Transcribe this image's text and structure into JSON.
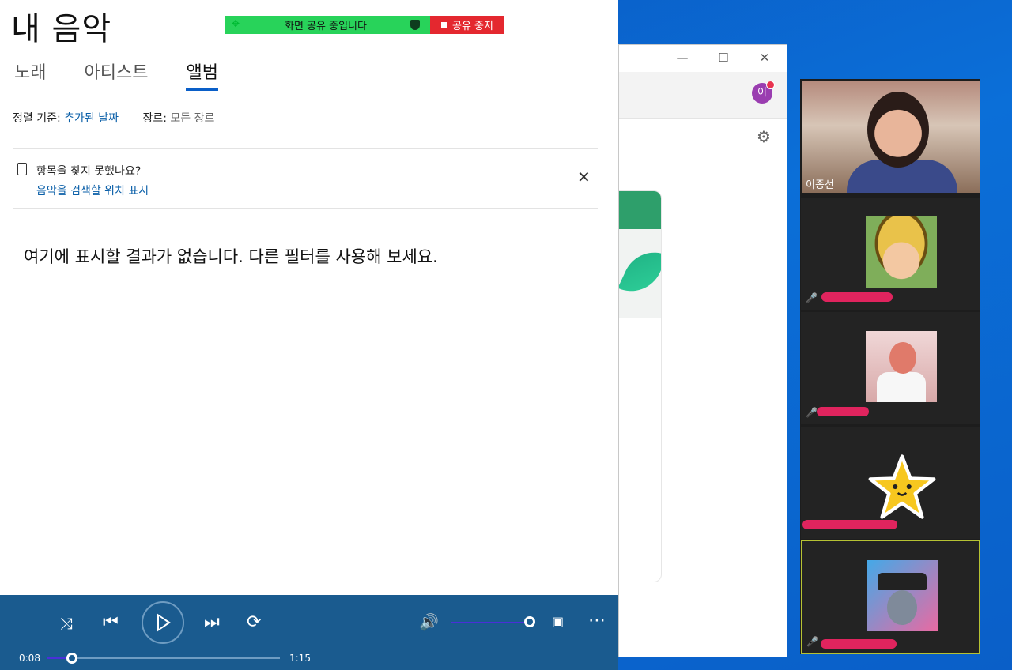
{
  "app": {
    "title": "내 음악",
    "tabs": [
      {
        "label": "노래",
        "active": false
      },
      {
        "label": "아티스트",
        "active": false
      },
      {
        "label": "앨범",
        "active": true
      }
    ],
    "sort_label": "정렬 기준:",
    "sort_value": "추가된 날짜",
    "genre_label": "장르:",
    "genre_value": "모든 장르",
    "notice_title": "항목을 찾지 못했나요?",
    "notice_link": "음악을 검색할 위치 표시",
    "empty_message": "여기에 표시할 결과가 없습니다. 다른 필터를 사용해 보세요."
  },
  "share_banner": {
    "status": "화면 공유 중입니다",
    "stop_label": "공유 중지",
    "status_color": "#28d35a",
    "stop_color": "#e4282f"
  },
  "player": {
    "elapsed": "0:08",
    "duration": "1:15",
    "progress": 0.107,
    "volume": 1.0,
    "icons": [
      "shuffle-icon",
      "previous-icon",
      "play-icon",
      "next-icon",
      "repeat-icon",
      "volume-icon",
      "mini-player-icon",
      "more-icon"
    ]
  },
  "browser": {
    "avatar_text": "이"
  },
  "meeting": {
    "participants": [
      {
        "name": "이종선",
        "type": "camera"
      },
      {
        "name": "",
        "type": "avatar",
        "muted": true
      },
      {
        "name": "",
        "type": "avatar",
        "muted": true
      },
      {
        "name": "",
        "type": "avatar",
        "muted": false
      },
      {
        "name": "",
        "type": "avatar",
        "muted": true,
        "active": true
      }
    ]
  },
  "colors": {
    "accent": "#0a5fc8",
    "link": "#0a5fa8",
    "player_bg": "#1a5b8f"
  }
}
